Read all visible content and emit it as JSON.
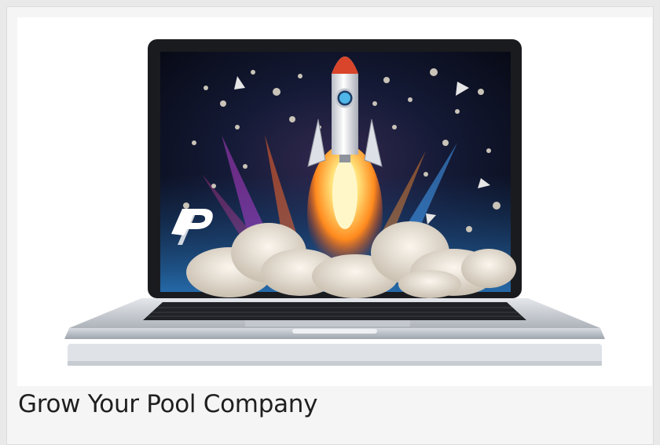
{
  "card": {
    "title": "Grow Your Pool Company"
  },
  "image": {
    "subject": "laptop-rocket-launch",
    "logo_icon": "brand-p-logo-icon",
    "colors": {
      "screen_dark": "#0a0d1e",
      "screen_blue": "#1d4f8c",
      "rocket_red": "#d8452a",
      "rocket_body": "#e8e8ec",
      "flame_core": "#fff2a8",
      "flame_outer": "#ff8a1e",
      "smoke": "#ede5d9",
      "laptop_silver": "#cfd3d9"
    }
  }
}
